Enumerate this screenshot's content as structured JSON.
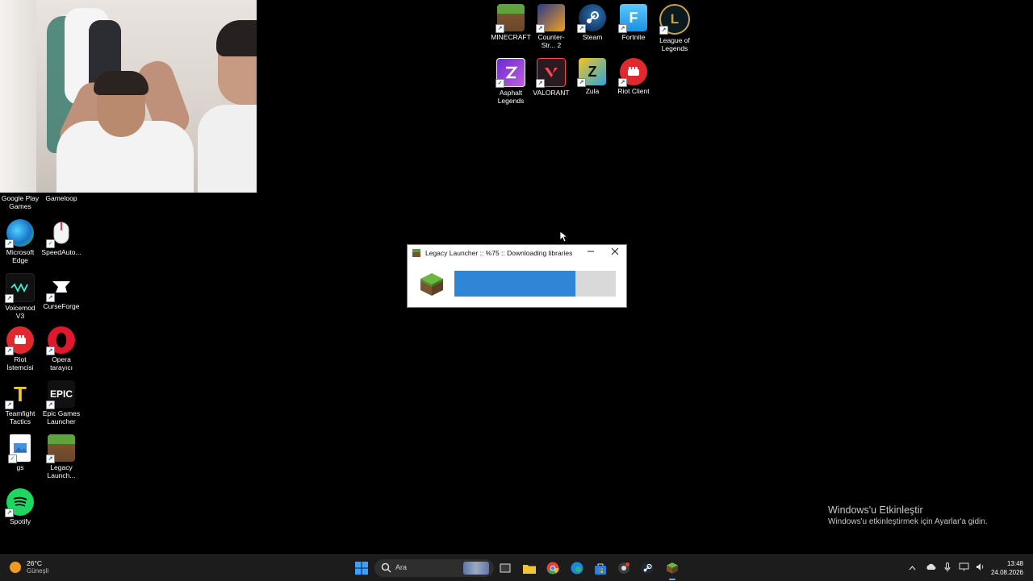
{
  "desktop_icons_top": [
    {
      "id": "minecraft",
      "label": "MINECRAFT"
    },
    {
      "id": "counter-strike",
      "label": "Counter-Str... 2"
    },
    {
      "id": "steam",
      "label": "Steam"
    },
    {
      "id": "fortnite",
      "label": "Fortnite"
    },
    {
      "id": "league",
      "label": "League of Legends"
    },
    {
      "id": "asphalt",
      "label": "Asphalt Legends"
    },
    {
      "id": "valorant",
      "label": "VALORANT"
    },
    {
      "id": "zula",
      "label": "Zula"
    },
    {
      "id": "riot-client",
      "label": "Riot Client"
    }
  ],
  "desktop_icons_left": [
    {
      "id": "google-play-games",
      "label": "Google Play Games"
    },
    {
      "id": "gameloop",
      "label": "Gameloop"
    },
    {
      "id": "edge",
      "label": "Microsoft Edge"
    },
    {
      "id": "speedauto",
      "label": "SpeedAuto..."
    },
    {
      "id": "voicemod",
      "label": "Voicemod V3"
    },
    {
      "id": "curseforge",
      "label": "CurseForge"
    },
    {
      "id": "riot-istemcisi",
      "label": "Riot İstemcisi"
    },
    {
      "id": "opera",
      "label": "Opera tarayıcı"
    },
    {
      "id": "teamfight",
      "label": "Teamfight Tactics"
    },
    {
      "id": "epic",
      "label": "Epic Games Launcher"
    },
    {
      "id": "gs",
      "label": "gs"
    },
    {
      "id": "legacy",
      "label": "Legacy Launch..."
    },
    {
      "id": "spotify",
      "label": "Spotify"
    }
  ],
  "epic_logo_text": "EPIC",
  "launcher_window": {
    "title": "Legacy Launcher :: %75 :: Downloading libraries",
    "progress": 0.75
  },
  "activation": {
    "heading": "Windows'u Etkinleştir",
    "subtext": "Windows'u etkinleştirmek için Ayarlar'a gidin."
  },
  "taskbar": {
    "weather_temp": "26°C",
    "weather_desc": "Güneşli",
    "search_placeholder": "Ara",
    "time": "13:48",
    "date": "24.08.2026"
  },
  "colors": {
    "accent": "#2f86d6",
    "desktop_bg": "#000000",
    "taskbar_bg": "#1c1c1c"
  }
}
